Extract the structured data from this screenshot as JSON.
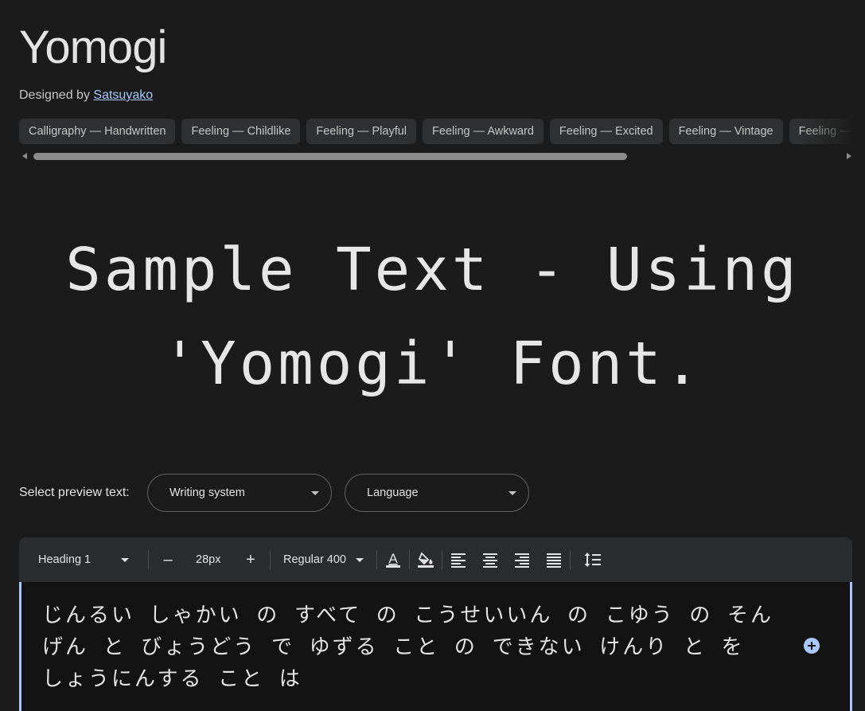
{
  "font": {
    "name": "Yomogi",
    "designed_by_label": "Designed by",
    "designer": "Satsuyako"
  },
  "tags": [
    "Calligraphy — Handwritten",
    "Feeling — Childlike",
    "Feeling — Playful",
    "Feeling — Awkward",
    "Feeling — Excited",
    "Feeling — Vintage",
    "Feeling — Happy"
  ],
  "sample": {
    "line1": "Sample Text - Using",
    "line2": "'Yomogi' Font."
  },
  "preview": {
    "label": "Select preview text:",
    "writing_system": "Writing system",
    "language": "Language"
  },
  "toolbar": {
    "style": "Heading 1",
    "decrease_symbol": "–",
    "size": "28px",
    "increase_symbol": "+",
    "weight": "Regular 400",
    "text_color_letter": "A"
  },
  "editor": {
    "text": "じんるい しゃかい の すべて の こうせいいん の こゆう の そんげん と びょうどう で ゆずる こと の できない けんり と を しょうにんする こと は"
  },
  "colors": {
    "background": "#1b1b1b",
    "chip": "#2f3031",
    "accent": "#a8c7fa",
    "toolbar": "#2b2c2e",
    "editor": "#131314"
  }
}
